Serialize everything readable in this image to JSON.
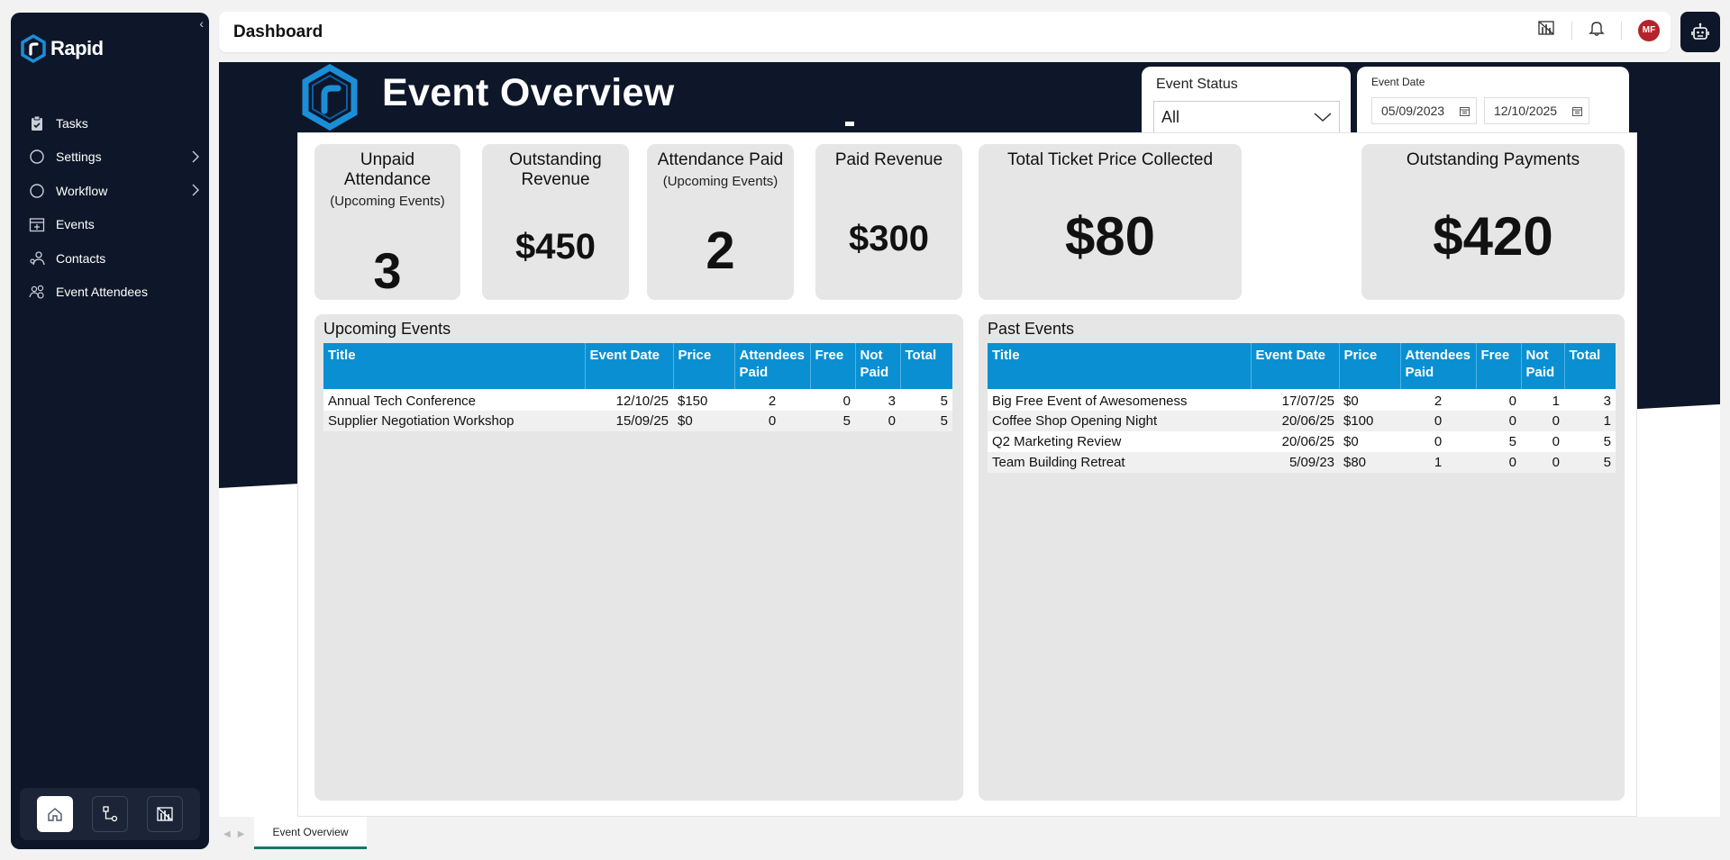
{
  "sidebar": {
    "brand": "Rapid",
    "items": [
      {
        "label": "Tasks",
        "icon": "clipboard-icon",
        "has_children": false
      },
      {
        "label": "Settings",
        "icon": "circle-icon",
        "has_children": true
      },
      {
        "label": "Workflow",
        "icon": "circle-icon",
        "has_children": true
      },
      {
        "label": "Events",
        "icon": "calendar-icon",
        "has_children": false
      },
      {
        "label": "Contacts",
        "icon": "contacts-icon",
        "has_children": false
      },
      {
        "label": "Event Attendees",
        "icon": "attendees-icon",
        "has_children": false
      }
    ],
    "bottom_buttons": [
      "home-icon",
      "workflow-icon",
      "powerbi-icon"
    ]
  },
  "header": {
    "title": "Dashboard",
    "avatar_initials": "MF"
  },
  "report": {
    "title": "Event Overview",
    "status_slicer": {
      "label": "Event Status",
      "value": "All"
    },
    "date_slicer": {
      "label": "Event Date",
      "start": "05/09/2023",
      "end": "12/10/2025"
    },
    "cards": [
      {
        "title": "Unpaid Attendance",
        "subtitle": "(Upcoming Events)",
        "value": "3"
      },
      {
        "title": "Outstanding Revenue",
        "subtitle": "",
        "value": "$450"
      },
      {
        "title": "Attendance Paid",
        "subtitle": "(Upcoming Events)",
        "value": "2"
      },
      {
        "title": "Paid Revenue",
        "subtitle": "",
        "value": "$300"
      },
      {
        "title": "Total Ticket Price Collected",
        "subtitle": "",
        "value": "$80"
      },
      {
        "title": "Outstanding Payments",
        "subtitle": "",
        "value": "$420"
      }
    ],
    "columns": [
      "Title",
      "Event Date",
      "Price",
      "Attendees Paid",
      "Free",
      "Not Paid",
      "Total"
    ],
    "upcoming": {
      "title": "Upcoming Events",
      "rows": [
        [
          "Annual Tech Conference",
          "12/10/25",
          "$150",
          "2",
          "0",
          "3",
          "5"
        ],
        [
          "Supplier Negotiation Workshop",
          "15/09/25",
          "$0",
          "0",
          "5",
          "0",
          "5"
        ]
      ]
    },
    "past": {
      "title": "Past Events",
      "rows": [
        [
          "Big Free Event of Awesomeness",
          "17/07/25",
          "$0",
          "2",
          "0",
          "1",
          "3"
        ],
        [
          "Coffee Shop Opening Night",
          "20/06/25",
          "$100",
          "0",
          "0",
          "0",
          "1"
        ],
        [
          "Q2 Marketing Review",
          "20/06/25",
          "$0",
          "0",
          "5",
          "0",
          "5"
        ],
        [
          "Team Building Retreat",
          "5/09/23",
          "$80",
          "1",
          "0",
          "0",
          "5"
        ]
      ]
    }
  },
  "page_tabs": [
    {
      "label": "Event Overview",
      "active": true
    }
  ],
  "colors": {
    "sidebar_bg": "#0e1729",
    "table_header": "#0a90d2",
    "card_bg": "#e6e6e6",
    "brand_blue": "#1a8fd8",
    "avatar": "#b3232b"
  }
}
